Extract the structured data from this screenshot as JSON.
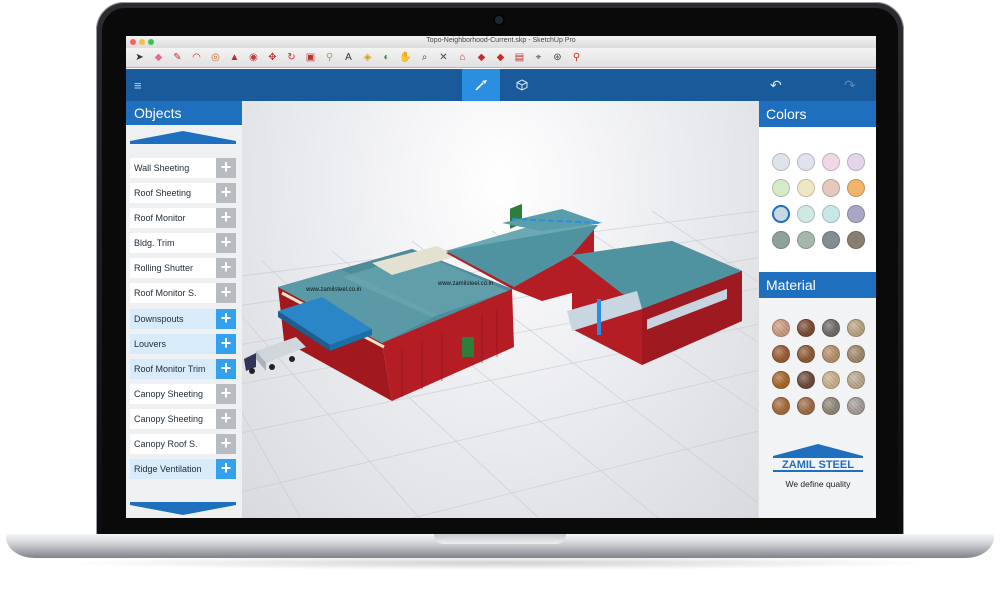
{
  "window": {
    "title": "Topo-Neighborhood-Current.skp - SketchUp Pro"
  },
  "toolbar_icons": [
    "select-icon",
    "eraser-icon",
    "pencil-icon",
    "arc-icon",
    "shapes-icon",
    "push-pull-icon",
    "follow-me-icon",
    "move-icon",
    "rotate-icon",
    "scale-icon",
    "tape-measure-icon",
    "text-icon",
    "paint-bucket-icon",
    "orbit-icon",
    "pan-icon",
    "zoom-icon",
    "zoom-extents-icon",
    "warehouse-icon",
    "extension-icon",
    "layout-icon",
    "send-icon",
    "position-camera-icon",
    "walk-icon"
  ],
  "appbar": {
    "menu_icon": "≡",
    "paint_tab_icon": "brush-icon",
    "model_tab_icon": "cube-icon",
    "undo_icon": "↶",
    "redo_icon": "↷"
  },
  "objects": {
    "title": "Objects",
    "items": [
      {
        "label": "Wall Sheeting",
        "highlighted": false
      },
      {
        "label": "Roof Sheeting",
        "highlighted": false
      },
      {
        "label": "Roof Monitor",
        "highlighted": false
      },
      {
        "label": "Bldg. Trim",
        "highlighted": false
      },
      {
        "label": "Rolling Shutter",
        "highlighted": false
      },
      {
        "label": "Roof Monitor S.",
        "highlighted": false
      },
      {
        "label": "Downspouts",
        "highlighted": true
      },
      {
        "label": "Louvers",
        "highlighted": true
      },
      {
        "label": "Roof Monitor Trim",
        "highlighted": true
      },
      {
        "label": "Canopy Sheeting",
        "highlighted": false
      },
      {
        "label": "Canopy Sheeting",
        "highlighted": false
      },
      {
        "label": "Canopy Roof S.",
        "highlighted": false
      },
      {
        "label": "Ridge Ventilation",
        "highlighted": true
      }
    ],
    "add_icon": "+"
  },
  "model": {
    "watermark_1": "www.zamilsteel.co.in",
    "watermark_2": "www.zamilsteel.co.in"
  },
  "colors": {
    "title": "Colors",
    "swatches": [
      "#dfe3ea",
      "#e1e2ef",
      "#f0d8e6",
      "#e3d6ea",
      "#d6ebc8",
      "#efe7c4",
      "#e6c8bc",
      "#f0b46a",
      "#c9d8e6",
      "#cfe8e4",
      "#c8e8e8",
      "#a8a6c3",
      "#8fa29a",
      "#a5b7ab",
      "#858d91",
      "#8a7e71"
    ],
    "selected_index": 8
  },
  "material": {
    "title": "Material",
    "swatches": [
      "#c99a80",
      "#7c4a36",
      "#6d6a67",
      "#b7a37f",
      "#9a5a32",
      "#8d5a35",
      "#b48e6a",
      "#a1876a",
      "#a5682c",
      "#6b4a3a",
      "#c7ad8a",
      "#b9a58a",
      "#a4693a",
      "#9d6b46",
      "#8f8576",
      "#a59a94"
    ]
  },
  "brand": {
    "name": "ZAMIL STEEL",
    "tagline": "We define quality",
    "color": "#1f6fbf"
  }
}
